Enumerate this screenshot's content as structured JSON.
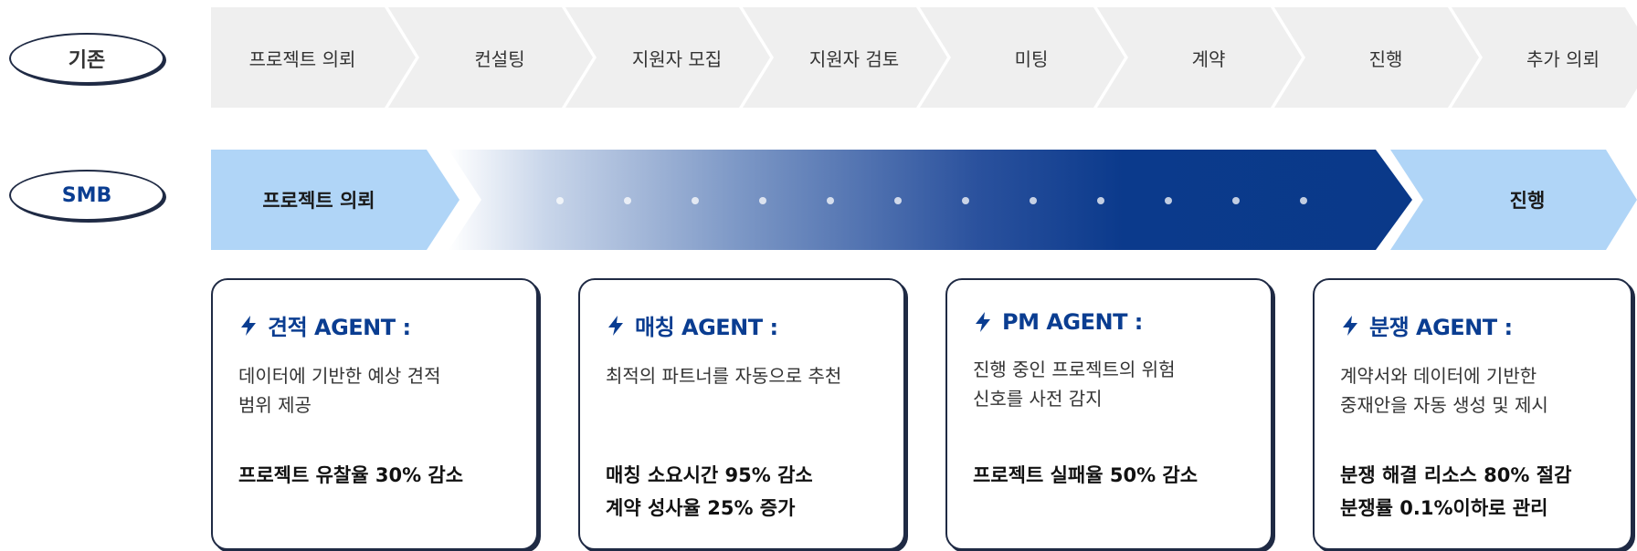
{
  "rows": {
    "old": {
      "label": "기존",
      "steps": [
        "프로젝트 의뢰",
        "컨설팅",
        "지원자 모집",
        "지원자 검토",
        "미팅",
        "계약",
        "진행",
        "추가 의뢰"
      ]
    },
    "smb": {
      "label": "SMB",
      "start": "프로젝트 의뢰",
      "end": "진행"
    }
  },
  "agents": [
    {
      "title": "견적 AGENT :",
      "desc": "데이터에 기반한 예상 견적\n범위 제공",
      "results": [
        "프로젝트 유찰율 30% 감소"
      ]
    },
    {
      "title": "매칭 AGENT :",
      "desc": "최적의 파트너를 자동으로 추천",
      "results": [
        "매칭 소요시간 95% 감소",
        "계약 성사율 25% 증가"
      ]
    },
    {
      "title": "PM AGENT :",
      "desc": "진행 중인 프로젝트의 위험\n신호를 사전 감지",
      "results": [
        "프로젝트 실패율 50% 감소"
      ]
    },
    {
      "title": "분쟁 AGENT :",
      "desc": "계약서와 데이터에 기반한\n중재안을 자동 생성 및 제시",
      "results": [
        "분쟁 해결 리소스 80% 절감",
        "분쟁률 0.1%이하로 관리"
      ]
    }
  ],
  "colors": {
    "accent": "#0a3d91",
    "light_chevron": "#b0d5f7",
    "grey_chevron": "#efefef",
    "outline": "#1f2a44"
  },
  "icons": {
    "agent": "lightning-bolt-icon"
  }
}
